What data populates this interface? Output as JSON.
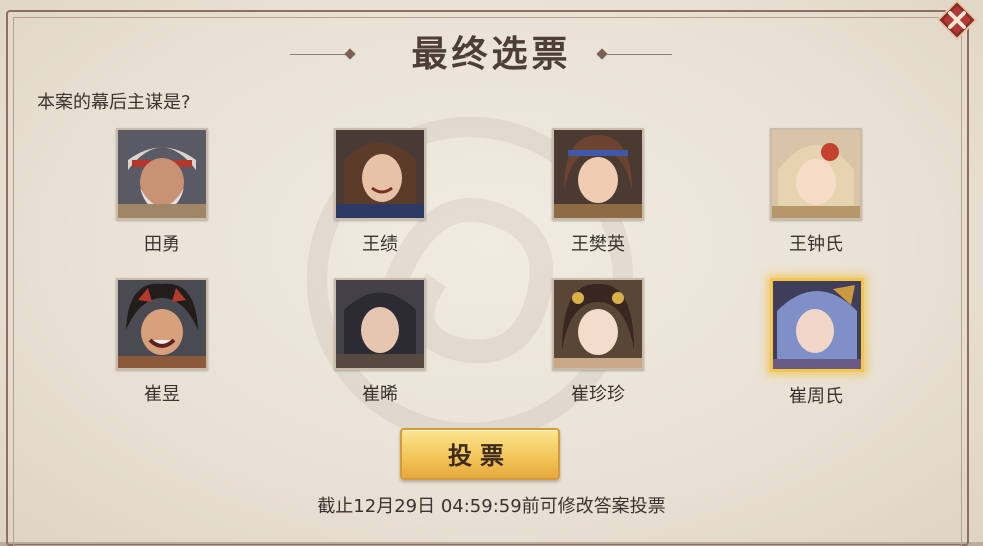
{
  "dialog": {
    "title": "最终选票",
    "question": "本案的幕后主谋是?",
    "close_icon": "close-icon"
  },
  "candidates": [
    {
      "name": "田勇",
      "selected": false
    },
    {
      "name": "王绩",
      "selected": false
    },
    {
      "name": "王樊英",
      "selected": false
    },
    {
      "name": "王钟氏",
      "selected": false
    },
    {
      "name": "崔昱",
      "selected": false
    },
    {
      "name": "崔晞",
      "selected": false
    },
    {
      "name": "崔珍珍",
      "selected": false
    },
    {
      "name": "崔周氏",
      "selected": true
    }
  ],
  "vote_button": {
    "label": "投票"
  },
  "deadline_text": "截止12月29日 04:59:59前可修改答案投票",
  "colors": {
    "accent_gold": "#f3c552",
    "title_brown": "#4d3f38",
    "frame_maroon": "#8f6e64"
  }
}
